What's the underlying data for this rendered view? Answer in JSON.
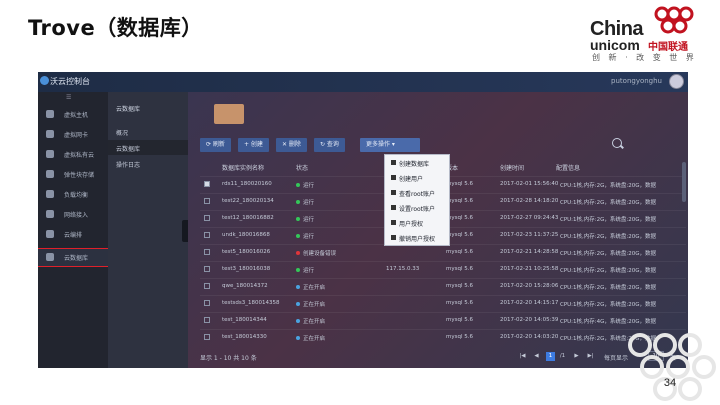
{
  "slide": {
    "title": "Trove（数据库）",
    "page_number": "34",
    "logo": {
      "line1": "China",
      "line2": "unicom",
      "cn": "中国联通",
      "slogan": "创 新 · 改 变 世 界"
    }
  },
  "console": {
    "brand": "沃云控制台",
    "user": "putongyonghu",
    "sidebar": {
      "toggle": "☰",
      "items": [
        {
          "label": "虚拟主机",
          "icon": "server-icon"
        },
        {
          "label": "虚拟网卡",
          "icon": "network-card-icon"
        },
        {
          "label": "虚拟私有云",
          "icon": "cloud-icon"
        },
        {
          "label": "弹性块存储",
          "icon": "storage-icon"
        },
        {
          "label": "负载均衡",
          "icon": "balance-icon"
        },
        {
          "label": "网络接入",
          "icon": "network-icon"
        },
        {
          "label": "云编排",
          "icon": "orchestration-icon"
        },
        {
          "label": "云数据库",
          "icon": "database-icon"
        }
      ]
    },
    "subnav": {
      "title": "云数据库",
      "items": [
        {
          "label": "概况"
        },
        {
          "label": "云数据库"
        },
        {
          "label": "操作日志"
        }
      ]
    },
    "toolbar": {
      "refresh": "⟳ 刷新",
      "create": "+ 创建",
      "delete": "✕ 删除",
      "query": "↻ 查询",
      "more": "更多操作 ▾"
    },
    "menu": [
      "创建数据库",
      "创建用户",
      "查看root账户",
      "设置root账户",
      "用户授权",
      "撤销用户授权"
    ],
    "table": {
      "headers": [
        "数据库实例名称",
        "状态",
        "",
        "版本",
        "创建时间",
        "配置信息"
      ],
      "rows": [
        {
          "name": "rds11_180020160",
          "status": "运行",
          "status_color": "#34c759",
          "ip": "",
          "version": "mysql 5.6",
          "time": "2017-02-01 15:56:40",
          "config": "CPU:1核,内存:2G，系统盘:20G，数据",
          "checked": true
        },
        {
          "name": "test22_180020134",
          "status": "运行",
          "status_color": "#34c759",
          "ip": "",
          "version": "mysql 5.6",
          "time": "2017-02-28 14:18:20",
          "config": "CPU:1核,内存:2G，系统盘:20G，数据",
          "checked": false
        },
        {
          "name": "test12_180016882",
          "status": "运行",
          "status_color": "#34c759",
          "ip": "",
          "version": "mysql 5.6",
          "time": "2017-02-27 09:24:43",
          "config": "CPU:1核,内存:2G，系统盘:20G，数据",
          "checked": false
        },
        {
          "name": "undk_180016868",
          "status": "运行",
          "status_color": "#34c759",
          "ip": "10.0.0.0/0",
          "version": "mysql 5.6",
          "time": "2017-02-23 11:37:25",
          "config": "CPU:1核,内存:2G，系统盘:20G，数据",
          "checked": false
        },
        {
          "name": "test5_180016026",
          "status": "创建设备错误",
          "status_color": "#e0353a",
          "ip": "",
          "version": "mysql 5.6",
          "time": "2017-02-21 14:28:58",
          "config": "CPU:1核,内存:2G，系统盘:20G，数据",
          "checked": false
        },
        {
          "name": "test3_180016038",
          "status": "运行",
          "status_color": "#34c759",
          "ip": "117.15.0.33",
          "version": "mysql 5.6",
          "time": "2017-02-21 10:25:58",
          "config": "CPU:1核,内存:2G，系统盘:20G，数据",
          "checked": false
        },
        {
          "name": "qwe_180014372",
          "status": "正在开启",
          "status_color": "#4aa3e0",
          "ip": "",
          "version": "mysql 5.6",
          "time": "2017-02-20 15:28:06",
          "config": "CPU:1核,内存:2G，系统盘:20G，数据",
          "checked": false
        },
        {
          "name": "testsds3_180014358",
          "status": "正在开启",
          "status_color": "#4aa3e0",
          "ip": "",
          "version": "mysql 5.6",
          "time": "2017-02-20 14:15:17",
          "config": "CPU:1核,内存:2G，系统盘:20G，数据",
          "checked": false
        },
        {
          "name": "test_180014344",
          "status": "正在开启",
          "status_color": "#4aa3e0",
          "ip": "",
          "version": "mysql 5.6",
          "time": "2017-02-20 14:05:39",
          "config": "CPU:1核,内存:4G，系统盘:20G，数据",
          "checked": false
        },
        {
          "name": "test_180014330",
          "status": "正在开启",
          "status_color": "#4aa3e0",
          "ip": "",
          "version": "mysql 5.6",
          "time": "2017-02-20 14:03:20",
          "config": "CPU:1核,内存:2G，系统盘:20G，数据",
          "checked": false
        }
      ]
    },
    "footer": {
      "summary": "显示 1 - 10 共 10 条",
      "pages": [
        "|◀",
        "◀",
        "1",
        "/1",
        "▶",
        "▶|"
      ],
      "page_size_label": "每页显示",
      "page_size": "10",
      "unit": "条"
    }
  }
}
